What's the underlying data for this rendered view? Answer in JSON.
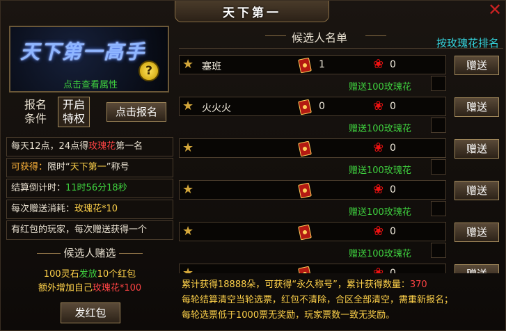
{
  "window": {
    "title": "天下第一",
    "close_icon": "✕"
  },
  "left": {
    "logo_text": "天下第一高手",
    "view_attr_link": "点击查看属性",
    "help_icon": "?",
    "condition_label": "报名条件",
    "condition_tag": "开启特权",
    "signup_button": "点击报名",
    "info": {
      "line1_a": "每天12点，24点得",
      "line1_b": "玫瑰花",
      "line1_c": "第一名",
      "line2_a": "可获得：",
      "line2_b": "限时“",
      "line2_c": "天下第一",
      "line2_d": "”称号",
      "line3_a": "结算倒计时：",
      "line3_b": "11时56分18秒",
      "line4_a": "每次赠送消耗：",
      "line4_b": "玫瑰花*10",
      "line5": "有红包的玩家，每次赠送获得一个"
    },
    "bet_title": "候选人赌选",
    "bet_line1_a": "100灵石",
    "bet_line1_b": "发放",
    "bet_line1_c": "10个红包",
    "bet_line2_a": "额外增加自己",
    "bet_line2_b": "玫瑰花*100",
    "send_button": "发红包"
  },
  "right": {
    "list_title": "候选人名单",
    "rank_link": "按玫瑰花排名",
    "gift_label": "赠送100玫瑰花",
    "gift_button": "赠送",
    "candidates": [
      {
        "name": "塞班",
        "red_packets": "1",
        "roses": "0"
      },
      {
        "name": "火火火",
        "red_packets": "0",
        "roses": "0"
      },
      {
        "name": "",
        "red_packets": "",
        "roses": "0"
      },
      {
        "name": "",
        "red_packets": "",
        "roses": "0"
      },
      {
        "name": "",
        "red_packets": "",
        "roses": "0"
      },
      {
        "name": "",
        "red_packets": "",
        "roses": "0"
      }
    ],
    "footer": {
      "l1_a": "累计获得18888朵，可获得“",
      "l1_b": "永久称号",
      "l1_c": "”，累计获得数量：",
      "l1_d": "370",
      "l2": "每轮结算清空当轮选票，红包不清除，合区全部清空，需重新报名；",
      "l3_a": "每轮选票低于1000票无奖励，",
      "l3_b": "玩家票数一致",
      "l3_c": "无奖励。"
    }
  },
  "colors": {
    "green": "#3fd23f",
    "red": "#ff4444",
    "yellow": "#ffd24a",
    "cyan": "#34d4dc",
    "gold_border": "#a38a5c"
  },
  "icons": {
    "star": "star-icon",
    "red_packet": "red-packet-icon",
    "rose": "rose-icon",
    "help": "help-icon",
    "close": "close-icon"
  }
}
